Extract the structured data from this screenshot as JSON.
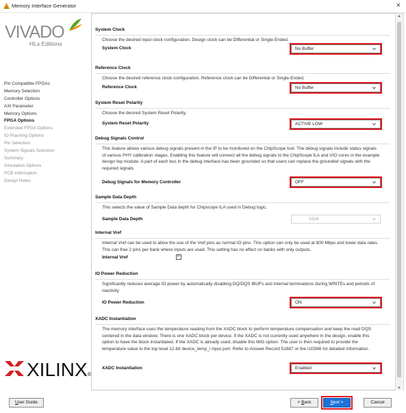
{
  "window": {
    "title": "Memory Interface Generator",
    "close_glyph": "×",
    "icon": "vivado-icon"
  },
  "branding": {
    "vivado": "VIVADO",
    "edition": "HLx Editions",
    "xilinx": "XILINX",
    "registered": "®"
  },
  "sidebar": {
    "items": [
      {
        "label": "Pin Compatible FPGAs",
        "state": "normal"
      },
      {
        "label": "Memory Selection",
        "state": "normal"
      },
      {
        "label": "Controller Options",
        "state": "normal"
      },
      {
        "label": "AXI Parameter",
        "state": "normal"
      },
      {
        "label": "Memory Options",
        "state": "normal"
      },
      {
        "label": "FPGA Options",
        "state": "active"
      },
      {
        "label": "Extended FPGA Options",
        "state": "disabled"
      },
      {
        "label": "IO Planning Options",
        "state": "disabled"
      },
      {
        "label": "Pin Selection",
        "state": "disabled"
      },
      {
        "label": "System Signals Selection",
        "state": "disabled"
      },
      {
        "label": "Summary",
        "state": "disabled"
      },
      {
        "label": "Simulation Options",
        "state": "disabled"
      },
      {
        "label": "PCB Information",
        "state": "disabled"
      },
      {
        "label": "Design Notes",
        "state": "disabled"
      }
    ]
  },
  "sections": {
    "system_clock": {
      "title": "System Clock",
      "desc": "Choose the desired input clock configuration. Design clock can be Differential or Single-Ended.",
      "label": "System Clock",
      "value": "No Buffer"
    },
    "reference_clock": {
      "title": "Reference Clock",
      "desc": "Choose the desired reference clock configuration. Reference clock can be Differential or Single-Ended.",
      "label": "Reference Clock",
      "value": "No Buffer"
    },
    "system_reset": {
      "title": "System Reset Polarity",
      "desc": "Choose the desired System Reset Polarity.",
      "label": "System Reset Polarity",
      "value": "ACTIVE LOW"
    },
    "debug_signals": {
      "title": "Debug Signals Control",
      "desc": "This feature allows various debug signals present in the IP to be monitored on the ChipScope tool. The debug signals include status signals of various PHY calibration stages. Enabling this feature will connect all the debug signals to the ChipScope ILA and VIO cores in the example design top module. A part of each bus in the debug interface has been grounded so that users can replace the grounded signals with the required signals.",
      "label": "Debug Signals for Memory Controller",
      "value": "OFF"
    },
    "sample_depth": {
      "title": "Sample Data Depth",
      "desc": "This selects the value of Sample Data depth for Chipscope ILA used in Debug logic.",
      "label": "Sample Data Depth",
      "value": "1024"
    },
    "internal_vref": {
      "title": "Internal Vref",
      "desc": "Internal Vref can be used to allow the use of the Vref pins as normal IO pins. This option can only be used at 800 Mbps and lower data rates. This can free 2 pins per bank where inputs are used. This setting has no effect on banks with only outputs.",
      "label": "Internal Vref",
      "checked": "✓"
    },
    "io_power": {
      "title": "IO Power Reduction",
      "desc": "Significantly reduces average IO power by automatically disabling DQ/DQS IBUFs and internal terminations during WRITEs and periods of inactivity",
      "label": "IO Power Reduction",
      "value": "ON"
    },
    "xadc": {
      "title": "XADC Instantiation",
      "desc": "The memory interface uses the temperature reading from the XADC block to perform temperature compensation and keep the read DQS centered in the data window. There is one XADC block per device. If the XADC is not currently used anywhere in the design, enable this option to have the block instantiated. If the XADC is already used, disable this MIG option. The user is then required to provide the temperature value to the top level 12-bit device_temp_i input port. Refer to Answer Record 51687 or the UG586 for detailed information.",
      "label": "XADC Instantiation",
      "value": "Enabled"
    }
  },
  "footer": {
    "user_guide": {
      "mnemonic": "U",
      "rest": "ser Guide"
    },
    "back": {
      "prefix": "< ",
      "mnemonic": "B",
      "rest": "ack"
    },
    "next": {
      "mnemonic": "N",
      "rest": "ext >"
    },
    "cancel": "Cancel"
  },
  "colors": {
    "accent_red": "#e0181f",
    "primary_blue": "#1e73d8",
    "logo_gray": "#8c8c8c",
    "leaf_green": "#5aa51e",
    "leaf_orange": "#f28b00",
    "xilinx_red": "#d51f26"
  }
}
